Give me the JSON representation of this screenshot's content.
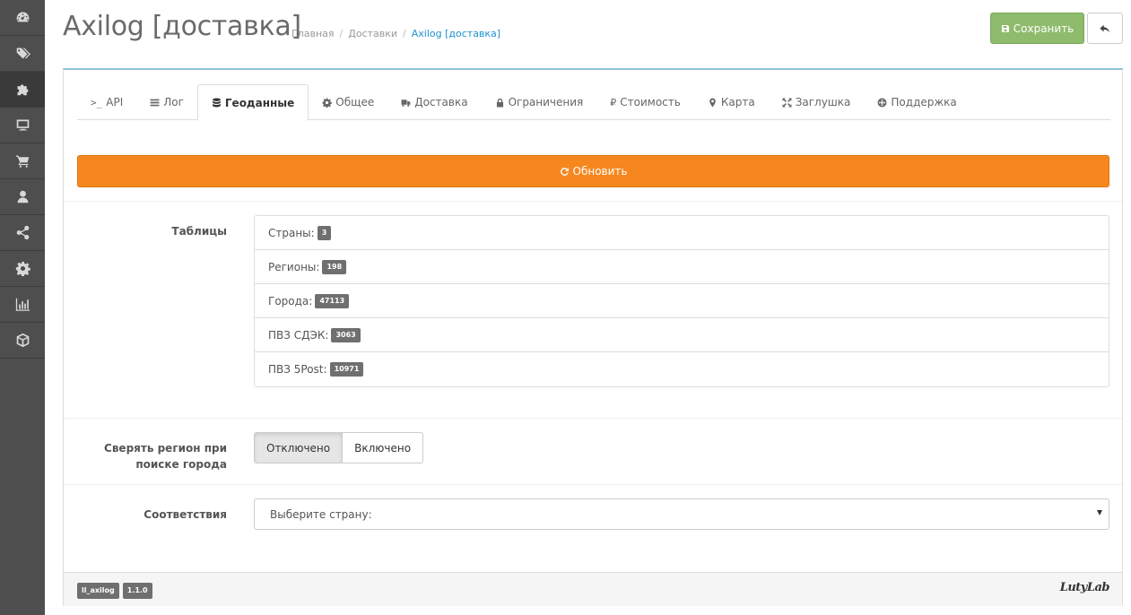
{
  "sidebar": {
    "items": [
      {
        "icon": "dashboard-icon"
      },
      {
        "icon": "tags-icon"
      },
      {
        "icon": "puzzle-icon",
        "active": true
      },
      {
        "icon": "desktop-icon"
      },
      {
        "icon": "shopping-cart-icon"
      },
      {
        "icon": "user-icon"
      },
      {
        "icon": "share-icon"
      },
      {
        "icon": "cog-icon"
      },
      {
        "icon": "bar-chart-icon"
      },
      {
        "icon": "cube-icon"
      }
    ]
  },
  "header": {
    "title": "Axilog [доставка]",
    "breadcrumb": [
      "Главная",
      "Доставки",
      "Axilog [доставка]"
    ],
    "save_label": "Сохранить"
  },
  "tabs": [
    {
      "label": "API",
      "icon": "terminal-icon"
    },
    {
      "label": "Лог",
      "icon": "list-icon"
    },
    {
      "label": "Геоданные",
      "icon": "database-icon",
      "active": true
    },
    {
      "label": "Общее",
      "icon": "cog-icon"
    },
    {
      "label": "Доставка",
      "icon": "truck-icon"
    },
    {
      "label": "Ограничения",
      "icon": "lock-icon"
    },
    {
      "label": "Стоимость",
      "icon": "ruble-icon"
    },
    {
      "label": "Карта",
      "icon": "map-marker-icon"
    },
    {
      "label": "Заглушка",
      "icon": "arrows-icon"
    },
    {
      "label": "Поддержка",
      "icon": "life-ring-icon"
    }
  ],
  "update_label": "Обновить",
  "tables": {
    "label": "Таблицы",
    "items": [
      {
        "name": "Страны:",
        "count": "3"
      },
      {
        "name": "Регионы:",
        "count": "198"
      },
      {
        "name": "Города:",
        "count": "47113"
      },
      {
        "name": "ПВЗ СДЭК:",
        "count": "3063"
      },
      {
        "name": "ПВЗ 5Post:",
        "count": "10971"
      }
    ]
  },
  "region_check": {
    "label_line1": "Сверять регион при",
    "label_line2": "поиске города",
    "options": [
      "Отключено",
      "Включено"
    ],
    "selected": "Отключено"
  },
  "mapping": {
    "label": "Соответствия",
    "select_value": "Выберите страну:"
  },
  "footer": {
    "module_name": "ll_axilog",
    "version": "1.1.0",
    "logo_text": "LutyLab"
  },
  "colors": {
    "sidebar": "#4e4e4e",
    "save": "#8fbb6c",
    "update": "#f6871f",
    "link": "#1e91cf",
    "panel_top": "#8fc2dc"
  }
}
